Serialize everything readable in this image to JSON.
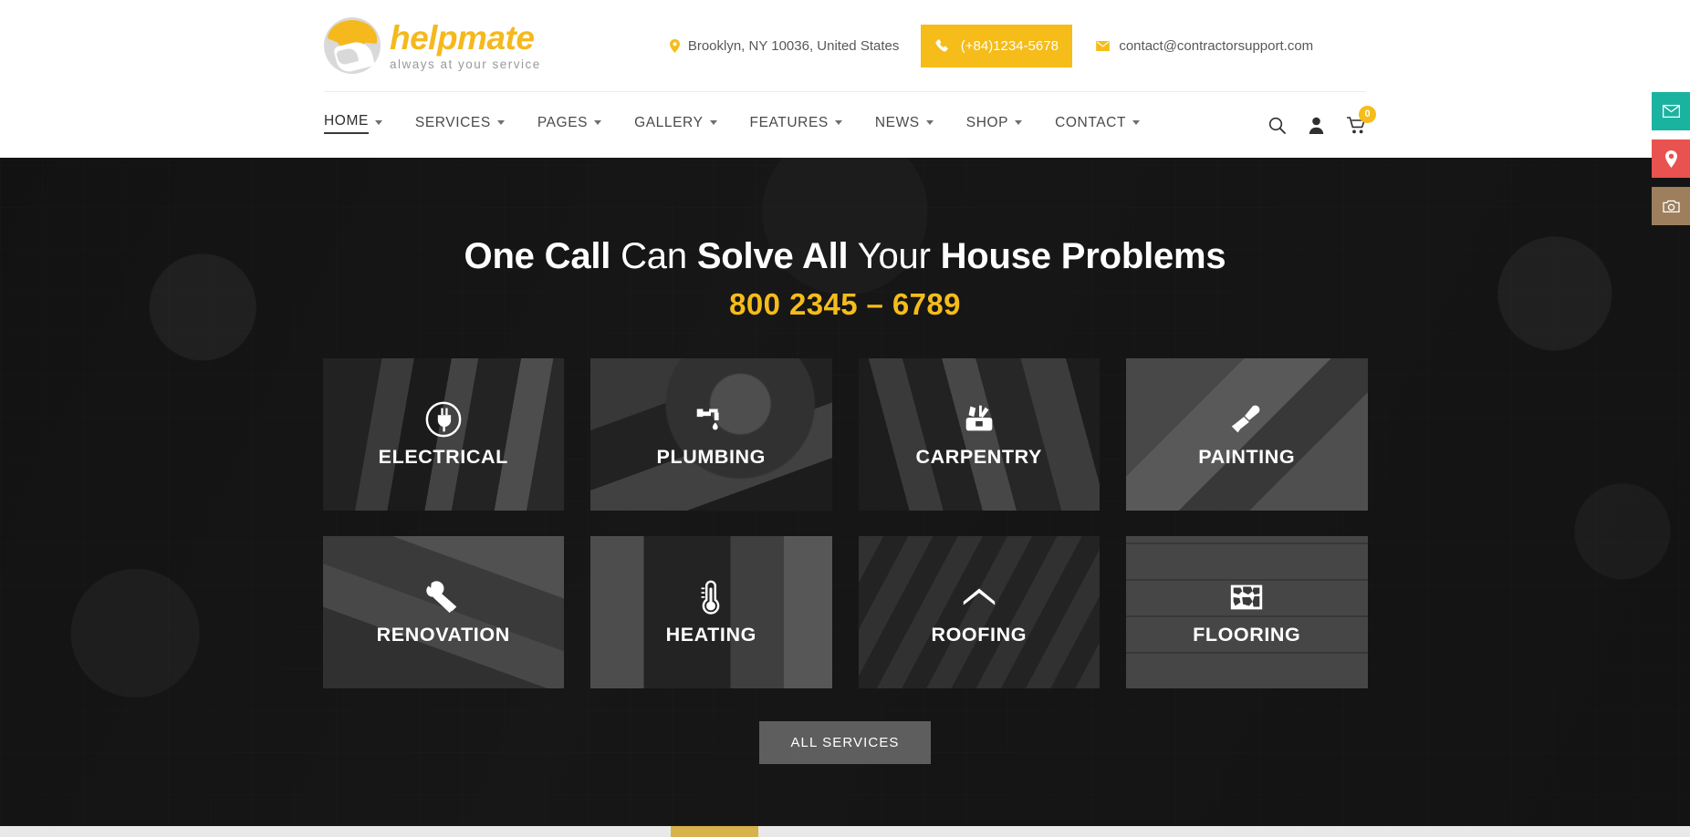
{
  "brand": {
    "name": "helpmate",
    "tagline": "always at your service",
    "accent": "#f5bc1a",
    "logo_icon": "helpmate-handshake-logo"
  },
  "topbar": {
    "address": "Brooklyn, NY 10036, United States",
    "address_icon": "location-pin-icon",
    "phone": "(+84)1234-5678",
    "phone_icon": "phone-icon",
    "email": "contact@contractorsupport.com",
    "email_icon": "envelope-icon"
  },
  "nav": {
    "items": [
      {
        "label": "HOME",
        "has_dropdown": true,
        "active": true
      },
      {
        "label": "SERVICES",
        "has_dropdown": true,
        "active": false
      },
      {
        "label": "PAGES",
        "has_dropdown": true,
        "active": false
      },
      {
        "label": "GALLERY",
        "has_dropdown": true,
        "active": false
      },
      {
        "label": "FEATURES",
        "has_dropdown": true,
        "active": false
      },
      {
        "label": "NEWS",
        "has_dropdown": true,
        "active": false
      },
      {
        "label": "SHOP",
        "has_dropdown": true,
        "active": false
      },
      {
        "label": "CONTACT",
        "has_dropdown": true,
        "active": false
      }
    ],
    "icons": {
      "search": "search-icon",
      "account": "user-icon",
      "cart": "shopping-cart-icon",
      "cart_count": "0"
    }
  },
  "hero": {
    "title_part1": "One Call",
    "title_part2": " Can ",
    "title_part3": "Solve All",
    "title_part4": " Your ",
    "title_part5": "House Problems",
    "phone": "800 2345 – 6789",
    "cta_label": "ALL SERVICES"
  },
  "services": [
    {
      "label": "ELECTRICAL",
      "icon": "electrical-plug-icon"
    },
    {
      "label": "PLUMBING",
      "icon": "faucet-drop-icon"
    },
    {
      "label": "CARPENTRY",
      "icon": "toolbox-icon"
    },
    {
      "label": "PAINTING",
      "icon": "paintbrush-icon"
    },
    {
      "label": "RENOVATION",
      "icon": "hammer-wrench-icon"
    },
    {
      "label": "HEATING",
      "icon": "thermometer-icon"
    },
    {
      "label": "ROOFING",
      "icon": "roof-icon"
    },
    {
      "label": "FLOORING",
      "icon": "stone-tile-icon"
    }
  ],
  "side_tabs": [
    {
      "icon": "envelope-icon",
      "color": "#1ab3a0"
    },
    {
      "icon": "map-pin-icon",
      "color": "#e8534f"
    },
    {
      "icon": "camera-icon",
      "color": "#9d7f5e"
    }
  ]
}
